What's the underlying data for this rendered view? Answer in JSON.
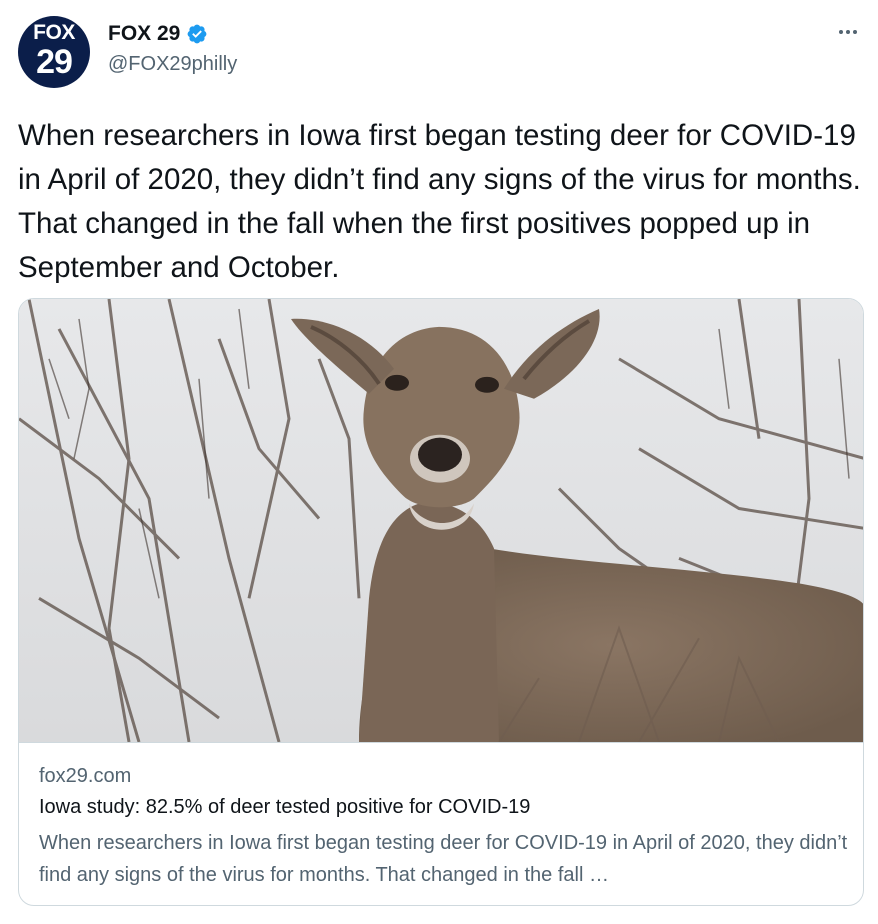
{
  "account": {
    "avatar_line1": "FOX",
    "avatar_line2": "29",
    "display_name": "FOX 29",
    "handle": "@FOX29philly",
    "verified": true
  },
  "tweet": {
    "text": "When researchers in Iowa first began testing deer for COVID-19 in April of 2020, they didn’t find any signs of the virus for months. That changed in the fall when the first positives popped up in September and October."
  },
  "card": {
    "image_subject": "deer standing among bare winter branches",
    "domain": "fox29.com",
    "title": "Iowa study: 82.5% of deer tested positive for COVID-19",
    "description": "When researchers in Iowa first began testing deer for COVID-19 in April of 2020, they didn’t find any signs of the virus for months. That changed in the fall …"
  },
  "icons": {
    "more": "more-horizontal-icon",
    "verified": "verified-badge-icon"
  },
  "colors": {
    "verified_blue": "#1d9bf0",
    "secondary_text": "#536471",
    "border": "#cfd9de",
    "avatar_bg": "#0b1e4a"
  }
}
